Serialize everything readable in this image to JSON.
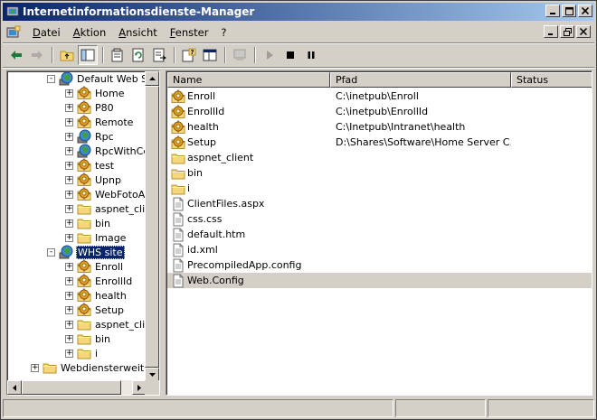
{
  "title": "Internetinformationsdienste-Manager",
  "menu": [
    "Datei",
    "Aktion",
    "Ansicht",
    "Fenster",
    "?"
  ],
  "tree": {
    "nodes": [
      {
        "label": "Default Web Sit",
        "icon": "globe-icon",
        "level": 1,
        "expander": "-",
        "selected": false
      },
      {
        "label": "Home",
        "icon": "gear-folder-icon",
        "level": 2,
        "expander": "+",
        "selected": false
      },
      {
        "label": "P80",
        "icon": "gear-folder-icon",
        "level": 2,
        "expander": "+",
        "selected": false
      },
      {
        "label": "Remote",
        "icon": "gear-folder-icon",
        "level": 2,
        "expander": "+",
        "selected": false
      },
      {
        "label": "Rpc",
        "icon": "globe-icon",
        "level": 2,
        "expander": "+",
        "selected": false
      },
      {
        "label": "RpcWithCer",
        "icon": "globe-icon",
        "level": 2,
        "expander": "+",
        "selected": false
      },
      {
        "label": "test",
        "icon": "gear-folder-icon",
        "level": 2,
        "expander": "+",
        "selected": false
      },
      {
        "label": "Upnp",
        "icon": "gear-folder-icon",
        "level": 2,
        "expander": "+",
        "selected": false
      },
      {
        "label": "WebFotoAll",
        "icon": "gear-folder-icon",
        "level": 2,
        "expander": "+",
        "selected": false
      },
      {
        "label": "aspnet_clie",
        "icon": "folder-icon",
        "level": 2,
        "expander": "+",
        "selected": false
      },
      {
        "label": "bin",
        "icon": "folder-icon",
        "level": 2,
        "expander": "+",
        "selected": false
      },
      {
        "label": "Image",
        "icon": "folder-icon",
        "level": 2,
        "expander": "+",
        "selected": false
      },
      {
        "label": "WHS site",
        "icon": "globe-icon",
        "level": 1,
        "expander": "-",
        "selected": true
      },
      {
        "label": "Enroll",
        "icon": "gear-folder-icon",
        "level": 2,
        "expander": "+",
        "selected": false
      },
      {
        "label": "EnrollId",
        "icon": "gear-folder-icon",
        "level": 2,
        "expander": "+",
        "selected": false
      },
      {
        "label": "health",
        "icon": "gear-folder-icon",
        "level": 2,
        "expander": "+",
        "selected": false
      },
      {
        "label": "Setup",
        "icon": "gear-folder-icon",
        "level": 2,
        "expander": "+",
        "selected": false
      },
      {
        "label": "aspnet_clie",
        "icon": "folder-icon",
        "level": 2,
        "expander": "+",
        "selected": false
      },
      {
        "label": "bin",
        "icon": "folder-icon",
        "level": 2,
        "expander": "+",
        "selected": false
      },
      {
        "label": "i",
        "icon": "folder-icon",
        "level": 2,
        "expander": "+",
        "selected": false
      },
      {
        "label": "Webdiensterweiter",
        "icon": "folder-icon",
        "level": 0,
        "expander": "+",
        "selected": false
      }
    ]
  },
  "list": {
    "columns": [
      "Name",
      "Pfad",
      "Status"
    ],
    "rows": [
      {
        "name": "Enroll",
        "path": "C:\\inetpub\\Enroll",
        "status": "",
        "icon": "gear-folder-icon",
        "selected": false
      },
      {
        "name": "EnrollId",
        "path": "C:\\inetpub\\EnrollId",
        "status": "",
        "icon": "gear-folder-icon",
        "selected": false
      },
      {
        "name": "health",
        "path": "C:\\Inetpub\\Intranet\\health",
        "status": "",
        "icon": "gear-folder-icon",
        "selected": false
      },
      {
        "name": "Setup",
        "path": "D:\\Shares\\Software\\Home Server C...",
        "status": "",
        "icon": "gear-folder-icon",
        "selected": false
      },
      {
        "name": "aspnet_client",
        "path": "",
        "status": "",
        "icon": "folder-icon",
        "selected": false
      },
      {
        "name": "bin",
        "path": "",
        "status": "",
        "icon": "folder-icon",
        "selected": false
      },
      {
        "name": "i",
        "path": "",
        "status": "",
        "icon": "folder-icon",
        "selected": false
      },
      {
        "name": "ClientFiles.aspx",
        "path": "",
        "status": "",
        "icon": "file-icon",
        "selected": false
      },
      {
        "name": "css.css",
        "path": "",
        "status": "",
        "icon": "file-icon",
        "selected": false
      },
      {
        "name": "default.htm",
        "path": "",
        "status": "",
        "icon": "file-icon",
        "selected": false
      },
      {
        "name": "id.xml",
        "path": "",
        "status": "",
        "icon": "file-icon",
        "selected": false
      },
      {
        "name": "PrecompiledApp.config",
        "path": "",
        "status": "",
        "icon": "file-icon",
        "selected": false
      },
      {
        "name": "Web.Config",
        "path": "",
        "status": "",
        "icon": "file-icon",
        "selected": true
      }
    ]
  },
  "colors": {
    "title_start": "#0a246a",
    "title_end": "#a6caf0",
    "selection": "#0a246a",
    "face": "#d4d0c8"
  }
}
